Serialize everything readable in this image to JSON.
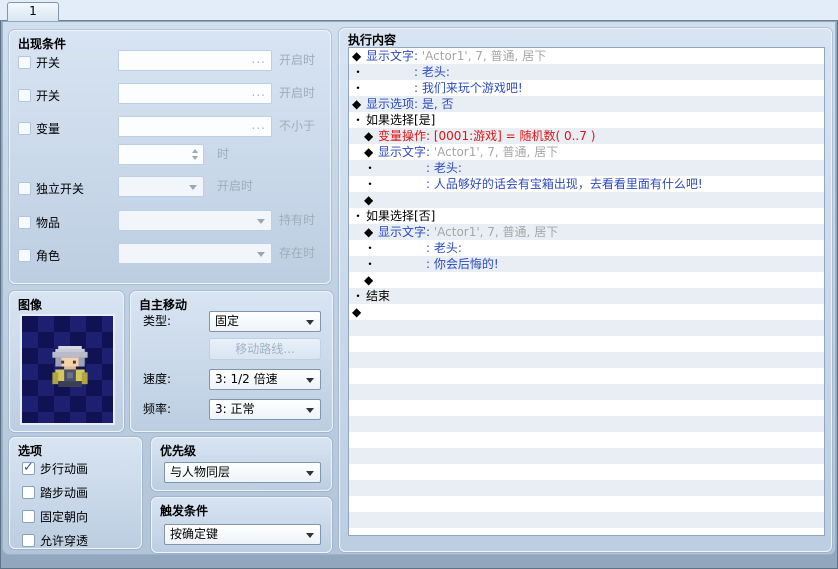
{
  "tab": {
    "label": "1"
  },
  "colors": {
    "blue": "#2b4bbf",
    "red": "#e01414",
    "gray": "#a6a6a6",
    "stripe": "#e9eef4"
  },
  "panels": {
    "appear": {
      "title": "出现条件",
      "switch1": {
        "label": "开关",
        "ellipsis": "...",
        "suffix": "开启时"
      },
      "switch2": {
        "label": "开关",
        "ellipsis": "...",
        "suffix": "开启时"
      },
      "variable": {
        "label": "变量",
        "ellipsis": "...",
        "suffix": "不小于",
        "value_suffix": "时"
      },
      "self_switch": {
        "label": "独立开关",
        "suffix": "开启时"
      },
      "item": {
        "label": "物品",
        "suffix": "持有时"
      },
      "actor": {
        "label": "角色",
        "suffix": "存在时"
      }
    },
    "graphic": {
      "title": "图像"
    },
    "autonomous": {
      "title": "自主移动",
      "type_label": "类型:",
      "type_value": "固定",
      "route_button": "移动路线...",
      "speed_label": "速度:",
      "speed_value": "3: 1/2 倍速",
      "freq_label": "频率:",
      "freq_value": "3: 正常"
    },
    "options": {
      "title": "选项",
      "items": [
        {
          "label": "步行动画",
          "checked": true
        },
        {
          "label": "踏步动画",
          "checked": false
        },
        {
          "label": "固定朝向",
          "checked": false
        },
        {
          "label": "允许穿透",
          "checked": false
        }
      ]
    },
    "priority": {
      "title": "优先级",
      "value": "与人物同层"
    },
    "trigger": {
      "title": "触发条件",
      "value": "按确定键"
    },
    "contents": {
      "title": "执行内容",
      "rows": [
        {
          "indent": 0,
          "bullet": "◆",
          "segs": [
            {
              "t": "显示文字: ",
              "c": "blue"
            },
            {
              "t": "'Actor1', 7, 普通, 居下",
              "c": "gray"
            }
          ]
        },
        {
          "indent": 0,
          "bullet": "・",
          "cont": true,
          "segs": [
            {
              "t": ": 老头:",
              "c": "blue"
            }
          ]
        },
        {
          "indent": 0,
          "bullet": "・",
          "cont": true,
          "segs": [
            {
              "t": ": 我们来玩个游戏吧!",
              "c": "blue"
            }
          ]
        },
        {
          "indent": 0,
          "bullet": "◆",
          "segs": [
            {
              "t": "显示选项: 是, 否",
              "c": "blue"
            }
          ]
        },
        {
          "indent": 0,
          "bullet": "・",
          "segs": [
            {
              "t": "如果选择[是]",
              "c": "black"
            }
          ]
        },
        {
          "indent": 1,
          "bullet": "◆",
          "segs": [
            {
              "t": "变量操作: [0001:游戏] = 随机数( 0..7 )",
              "c": "red"
            }
          ]
        },
        {
          "indent": 1,
          "bullet": "◆",
          "segs": [
            {
              "t": "显示文字: ",
              "c": "blue"
            },
            {
              "t": "'Actor1', 7, 普通, 居下",
              "c": "gray"
            }
          ]
        },
        {
          "indent": 1,
          "bullet": "・",
          "cont": true,
          "segs": [
            {
              "t": ": 老头:",
              "c": "blue"
            }
          ]
        },
        {
          "indent": 1,
          "bullet": "・",
          "cont": true,
          "segs": [
            {
              "t": ": 人品够好的话会有宝箱出现，去看看里面有什么吧!",
              "c": "blue"
            }
          ]
        },
        {
          "indent": 1,
          "bullet": "◆",
          "segs": []
        },
        {
          "indent": 0,
          "bullet": "・",
          "segs": [
            {
              "t": "如果选择[否]",
              "c": "black"
            }
          ]
        },
        {
          "indent": 1,
          "bullet": "◆",
          "segs": [
            {
              "t": "显示文字: ",
              "c": "blue"
            },
            {
              "t": "'Actor1', 7, 普通, 居下",
              "c": "gray"
            }
          ]
        },
        {
          "indent": 1,
          "bullet": "・",
          "cont": true,
          "segs": [
            {
              "t": ": 老头:",
              "c": "blue"
            }
          ]
        },
        {
          "indent": 1,
          "bullet": "・",
          "cont": true,
          "segs": [
            {
              "t": ": 你会后悔的!",
              "c": "blue"
            }
          ]
        },
        {
          "indent": 1,
          "bullet": "◆",
          "segs": []
        },
        {
          "indent": 0,
          "bullet": "・",
          "segs": [
            {
              "t": "结束",
              "c": "black"
            }
          ]
        },
        {
          "indent": 0,
          "bullet": "◆",
          "segs": []
        }
      ]
    }
  }
}
